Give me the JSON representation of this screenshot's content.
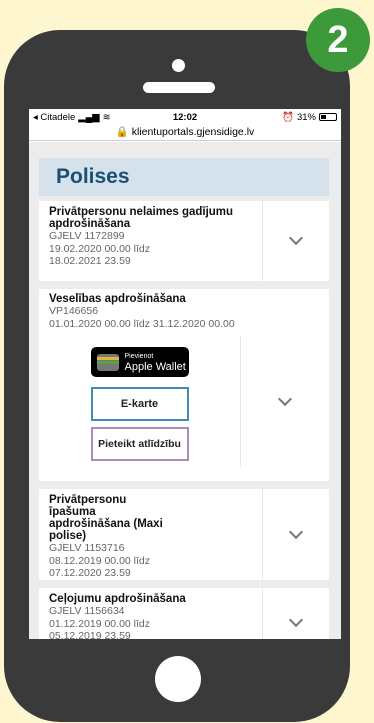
{
  "badge": {
    "number": "2"
  },
  "status_bar": {
    "carrier": "◂ Citadele",
    "signal": "▂▄▆",
    "wifi": "≋",
    "time": "12:02",
    "battery_percent": "31%"
  },
  "browser": {
    "url": "klientuportals.gjensidige.lv"
  },
  "page": {
    "title": "Polises",
    "policies": [
      {
        "title": "Privātpersonu nelaimes gadījumu apdrošināšana",
        "code": "GJELV 1172899",
        "line1": "19.02.2020 00.00 līdz",
        "line2": "18.02.2021 23.59"
      },
      {
        "title": "Privātpersonu īpašuma apdrošināšana (Maxi polise)",
        "code": "GJELV 1153716",
        "line1": "08.12.2019 00.00 līdz",
        "line2": "07.12.2020 23.59"
      },
      {
        "title": "Ceļojumu apdrošināšana",
        "code": "GJELV 1156634",
        "line1": "01.12.2019 00.00 līdz",
        "line2": "05.12.2019 23.59"
      }
    ],
    "expanded": {
      "title": "Veselības apdrošināšana",
      "code": "VP146656",
      "period": "01.01.2020 00.00 līdz 31.12.2020 00.00",
      "wallet_small": "Pievienot",
      "wallet_big": "Apple Wallet",
      "ekarte": "E-karte",
      "claim": "Pieteikt atlīdzību"
    }
  }
}
